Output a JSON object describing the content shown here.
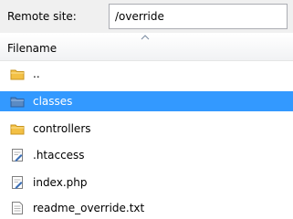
{
  "path_bar": {
    "label": "Remote site:",
    "value": "/override"
  },
  "file_list": {
    "column_header": "Filename",
    "sort": "ascending",
    "items": [
      {
        "name": "..",
        "icon": "folder-up-icon",
        "type": "folder"
      },
      {
        "name": "classes",
        "icon": "folder-icon",
        "type": "folder",
        "selected": true
      },
      {
        "name": "controllers",
        "icon": "folder-icon",
        "type": "folder"
      },
      {
        "name": ".htaccess",
        "icon": "file-edit-icon",
        "type": "file"
      },
      {
        "name": "index.php",
        "icon": "file-edit-icon",
        "type": "file"
      },
      {
        "name": "readme_override.txt",
        "icon": "text-file-icon",
        "type": "file"
      }
    ]
  },
  "colors": {
    "selection": "#3399ff",
    "folder": "#f3c044",
    "folder_selected": "#5b8bc4"
  }
}
